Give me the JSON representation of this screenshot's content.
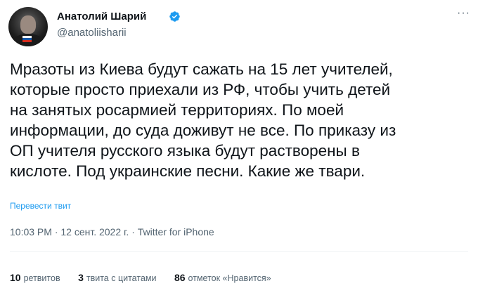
{
  "author": {
    "name": "Анатолий Шарий",
    "handle": "@anatoliisharii",
    "verified": true
  },
  "tweet": {
    "lines": [
      "Мразоты из Киева будут сажать на 15 лет учителей,",
      "которые просто приехали из РФ, чтобы учить детей",
      "на занятых росармией территориях. По моей",
      "информации, до суда доживут не все. По приказу из",
      "ОП учителя русского языка будут растворены в",
      "кислоте. Под украинские песни. Какие же твари."
    ],
    "translate_label": "Перевести твит",
    "meta": "10:03 PM · 12 сент. 2022 г. · Twitter for iPhone"
  },
  "stats": {
    "retweets_count": "10",
    "retweets_label": "ретвитов",
    "quotes_count": "3",
    "quotes_label": "твита с цитатами",
    "likes_count": "86",
    "likes_label": "отметок «Нравится»"
  },
  "icons": {
    "more": "more-dots-icon",
    "verified": "verified-badge-icon"
  },
  "colors": {
    "text": "#0f1419",
    "secondary": "#536471",
    "accent": "#1d9bf0"
  }
}
